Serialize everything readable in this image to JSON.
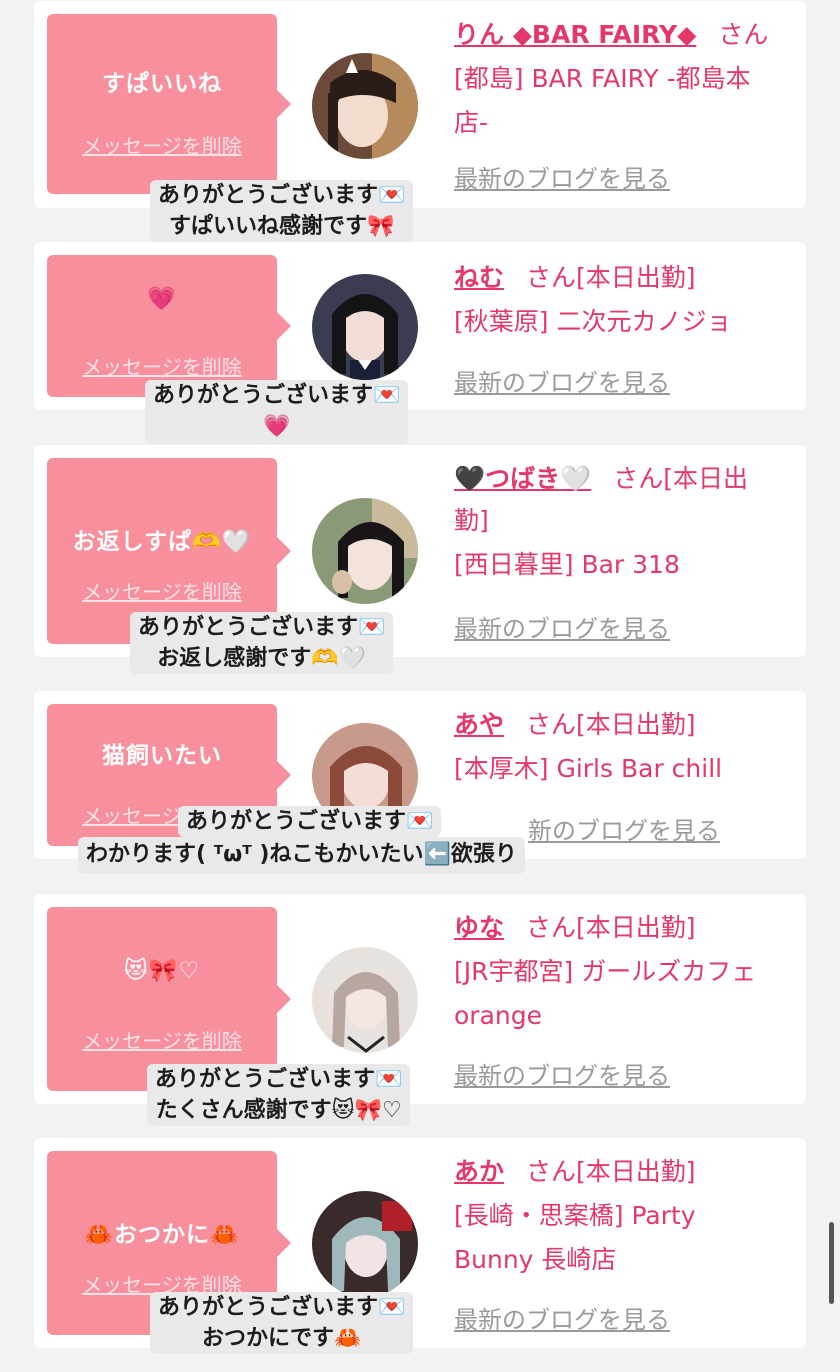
{
  "cards": [
    {
      "bubble_msg": "すぱいいね",
      "delete_label": "メッセージを削除",
      "name": "りん ◆BAR FAIRY◆",
      "san": "さん",
      "shop_line1": "[都島] BAR FAIRY -都島本",
      "shop_line2": "店-",
      "blog_label": "最新のブログを見る",
      "reply_line1": "ありがとうございます💌",
      "reply_line2": "すぱいいね感謝です🎀"
    },
    {
      "bubble_msg": "💗",
      "delete_label": "メッセージを削除",
      "name": "ねむ",
      "san": "さん[本日出勤]",
      "shop_line1": "[秋葉原] 二次元カノジョ",
      "blog_label": "最新のブログを見る",
      "reply_line1": "ありがとうございます💌",
      "reply_line2": "💗"
    },
    {
      "bubble_msg": "お返しすぱ🫶🤍",
      "delete_label": "メッセージを削除",
      "name": "🖤つばき🤍",
      "san": "さん[本日出",
      "san_line2": "勤]",
      "shop_line1": "[西日暮里] Bar 318",
      "blog_label": "最新のブログを見る",
      "reply_line1": "ありがとうございます💌",
      "reply_line2": "お返し感謝です🫶🤍"
    },
    {
      "bubble_msg": "猫飼いたい",
      "delete_label": "メッセージを削除",
      "name": "あや",
      "san": "さん[本日出勤]",
      "shop_line1": "[本厚木] Girls Bar chill",
      "blog_label": "新のブログを見る",
      "reply_line1": "ありがとうございます💌",
      "reply_line2": "わかります( ᵀωᵀ )ねこもかいたい⬅️欲張り"
    },
    {
      "bubble_msg": "😻🎀♡",
      "delete_label": "メッセージを削除",
      "name": "ゆな",
      "san": "さん[本日出勤]",
      "shop_line1": "[JR宇都宮] ガールズカフェ",
      "shop_line2": "orange",
      "blog_label": "最新のブログを見る",
      "reply_line1": "ありがとうございます💌",
      "reply_line2": "たくさん感謝です😻🎀♡"
    },
    {
      "bubble_msg": "🦀おつかに🦀",
      "delete_label": "メッセージを削除",
      "name": "あか",
      "san": "さん[本日出勤]",
      "shop_line1": "[長崎・思案橋] Party",
      "shop_line2": "Bunny 長崎店",
      "blog_label": "最新のブログを見る",
      "reply_line1": "ありがとうございます💌",
      "reply_line2": "おつかにです🦀"
    }
  ],
  "colors": {
    "accent": "#e5386a",
    "bubble": "#f7909c",
    "background": "#f2f2f2"
  }
}
